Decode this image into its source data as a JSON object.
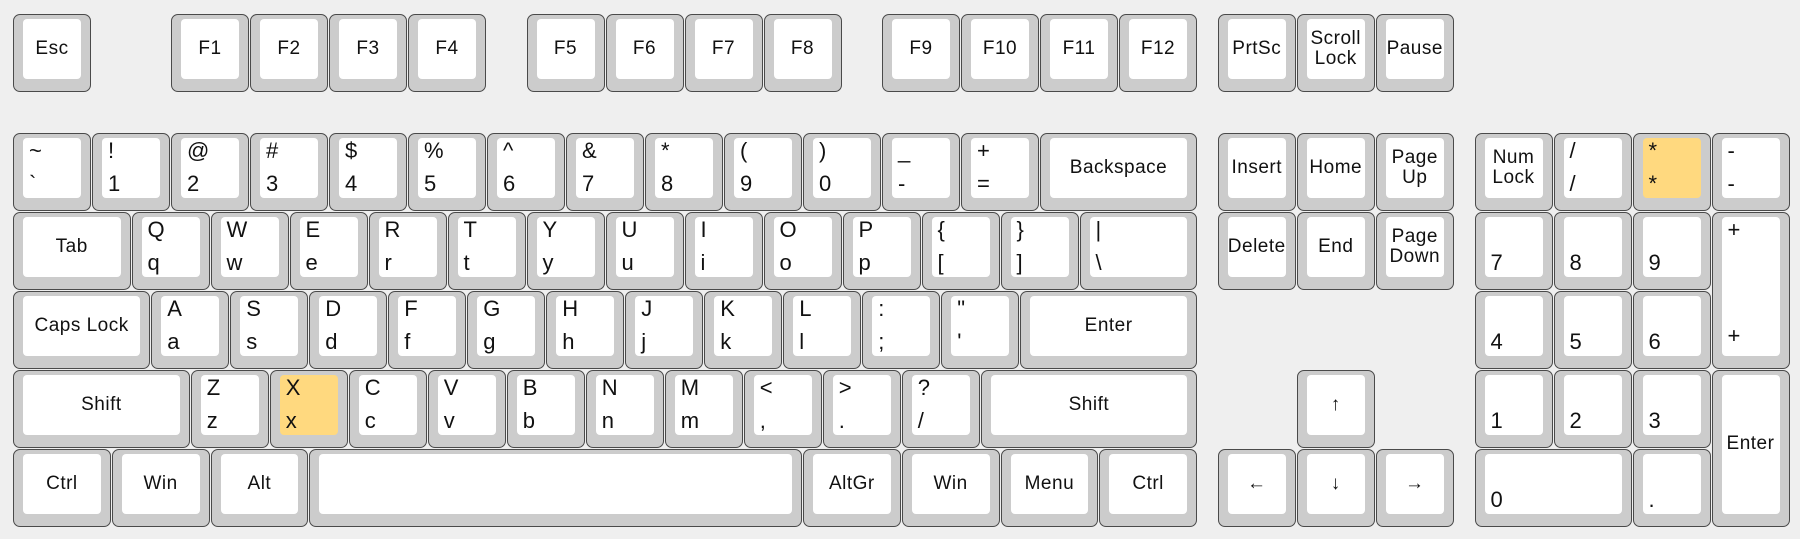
{
  "colors": {
    "background": "#efefef",
    "key_outer": "#cccccc",
    "key_cap": "#ffffff",
    "highlight": "#ffd97f"
  },
  "keys": [
    {
      "id": "esc",
      "label": "Esc"
    },
    {
      "id": "f1",
      "label": "F1"
    },
    {
      "id": "f2",
      "label": "F2"
    },
    {
      "id": "f3",
      "label": "F3"
    },
    {
      "id": "f4",
      "label": "F4"
    },
    {
      "id": "f5",
      "label": "F5"
    },
    {
      "id": "f6",
      "label": "F6"
    },
    {
      "id": "f7",
      "label": "F7"
    },
    {
      "id": "f8",
      "label": "F8"
    },
    {
      "id": "f9",
      "label": "F9"
    },
    {
      "id": "f10",
      "label": "F10"
    },
    {
      "id": "f11",
      "label": "F11"
    },
    {
      "id": "f12",
      "label": "F12"
    },
    {
      "id": "prtsc",
      "label": "PrtSc"
    },
    {
      "id": "scrolllock",
      "label": "Scroll\nLock"
    },
    {
      "id": "pause",
      "label": "Pause"
    },
    {
      "id": "backtick",
      "top": "~",
      "bottom": "`"
    },
    {
      "id": "1",
      "top": "!",
      "bottom": "1"
    },
    {
      "id": "2",
      "top": "@",
      "bottom": "2"
    },
    {
      "id": "3",
      "top": "#",
      "bottom": "3"
    },
    {
      "id": "4",
      "top": "$",
      "bottom": "4"
    },
    {
      "id": "5",
      "top": "%",
      "bottom": "5"
    },
    {
      "id": "6",
      "top": "^",
      "bottom": "6"
    },
    {
      "id": "7",
      "top": "&",
      "bottom": "7"
    },
    {
      "id": "8",
      "top": "*",
      "bottom": "8"
    },
    {
      "id": "9",
      "top": "(",
      "bottom": "9"
    },
    {
      "id": "0",
      "top": ")",
      "bottom": "0"
    },
    {
      "id": "minus",
      "top": "_",
      "bottom": "-"
    },
    {
      "id": "equal",
      "top": "+",
      "bottom": "="
    },
    {
      "id": "backspace",
      "label": "Backspace"
    },
    {
      "id": "tab",
      "label": "Tab"
    },
    {
      "id": "q",
      "top": "Q",
      "bottom": "q"
    },
    {
      "id": "w",
      "top": "W",
      "bottom": "w"
    },
    {
      "id": "e",
      "top": "E",
      "bottom": "e"
    },
    {
      "id": "r",
      "top": "R",
      "bottom": "r"
    },
    {
      "id": "t",
      "top": "T",
      "bottom": "t"
    },
    {
      "id": "y",
      "top": "Y",
      "bottom": "y"
    },
    {
      "id": "u",
      "top": "U",
      "bottom": "u"
    },
    {
      "id": "i",
      "top": "I",
      "bottom": "i"
    },
    {
      "id": "o",
      "top": "O",
      "bottom": "o"
    },
    {
      "id": "p",
      "top": "P",
      "bottom": "p"
    },
    {
      "id": "lbracket",
      "top": "{",
      "bottom": "["
    },
    {
      "id": "rbracket",
      "top": "}",
      "bottom": "]"
    },
    {
      "id": "backslash",
      "top": "|",
      "bottom": "\\"
    },
    {
      "id": "capslock",
      "label": "Caps Lock"
    },
    {
      "id": "a",
      "top": "A",
      "bottom": "a"
    },
    {
      "id": "s",
      "top": "S",
      "bottom": "s"
    },
    {
      "id": "d",
      "top": "D",
      "bottom": "d"
    },
    {
      "id": "f",
      "top": "F",
      "bottom": "f"
    },
    {
      "id": "g",
      "top": "G",
      "bottom": "g"
    },
    {
      "id": "h",
      "top": "H",
      "bottom": "h"
    },
    {
      "id": "j",
      "top": "J",
      "bottom": "j"
    },
    {
      "id": "k",
      "top": "K",
      "bottom": "k"
    },
    {
      "id": "l",
      "top": "L",
      "bottom": "l"
    },
    {
      "id": "semicolon",
      "top": ":",
      "bottom": ";"
    },
    {
      "id": "quote",
      "top": "\"",
      "bottom": "'"
    },
    {
      "id": "enter",
      "label": "Enter"
    },
    {
      "id": "lshift",
      "label": "Shift"
    },
    {
      "id": "z",
      "top": "Z",
      "bottom": "z"
    },
    {
      "id": "x",
      "top": "X",
      "bottom": "x",
      "highlighted": true
    },
    {
      "id": "c",
      "top": "C",
      "bottom": "c"
    },
    {
      "id": "v",
      "top": "V",
      "bottom": "v"
    },
    {
      "id": "b",
      "top": "B",
      "bottom": "b"
    },
    {
      "id": "n",
      "top": "N",
      "bottom": "n"
    },
    {
      "id": "m",
      "top": "M",
      "bottom": "m"
    },
    {
      "id": "comma",
      "top": "<",
      "bottom": ","
    },
    {
      "id": "period",
      "top": ">",
      "bottom": "."
    },
    {
      "id": "slash",
      "top": "?",
      "bottom": "/"
    },
    {
      "id": "rshift",
      "label": "Shift"
    },
    {
      "id": "lctrl",
      "label": "Ctrl"
    },
    {
      "id": "lwin",
      "label": "Win"
    },
    {
      "id": "lalt",
      "label": "Alt"
    },
    {
      "id": "space",
      "label": ""
    },
    {
      "id": "altgr",
      "label": "AltGr"
    },
    {
      "id": "rwin",
      "label": "Win"
    },
    {
      "id": "menu",
      "label": "Menu"
    },
    {
      "id": "rctrl",
      "label": "Ctrl"
    },
    {
      "id": "insert",
      "label": "Insert"
    },
    {
      "id": "home",
      "label": "Home"
    },
    {
      "id": "pageup",
      "label": "Page\nUp"
    },
    {
      "id": "delete",
      "label": "Delete"
    },
    {
      "id": "end",
      "label": "End"
    },
    {
      "id": "pagedown",
      "label": "Page\nDown"
    },
    {
      "id": "up",
      "label": "↑"
    },
    {
      "id": "left",
      "label": "←"
    },
    {
      "id": "down",
      "label": "↓"
    },
    {
      "id": "right",
      "label": "→"
    },
    {
      "id": "numlock",
      "label": "Num\nLock"
    },
    {
      "id": "numdiv",
      "top": "/",
      "bottom": "/"
    },
    {
      "id": "nummul",
      "top": "*",
      "bottom": "*",
      "highlighted": true
    },
    {
      "id": "numsub",
      "top": "-",
      "bottom": "-"
    },
    {
      "id": "num7",
      "bottom": "7"
    },
    {
      "id": "num8",
      "bottom": "8"
    },
    {
      "id": "num9",
      "bottom": "9"
    },
    {
      "id": "numadd",
      "top": "+",
      "bottom": "+"
    },
    {
      "id": "num4",
      "bottom": "4"
    },
    {
      "id": "num5",
      "bottom": "5"
    },
    {
      "id": "num6",
      "bottom": "6"
    },
    {
      "id": "num1",
      "bottom": "1"
    },
    {
      "id": "num2",
      "bottom": "2"
    },
    {
      "id": "num3",
      "bottom": "3"
    },
    {
      "id": "numenter",
      "label": "Enter"
    },
    {
      "id": "num0",
      "bottom": "0"
    },
    {
      "id": "numdot",
      "bottom": "."
    }
  ]
}
